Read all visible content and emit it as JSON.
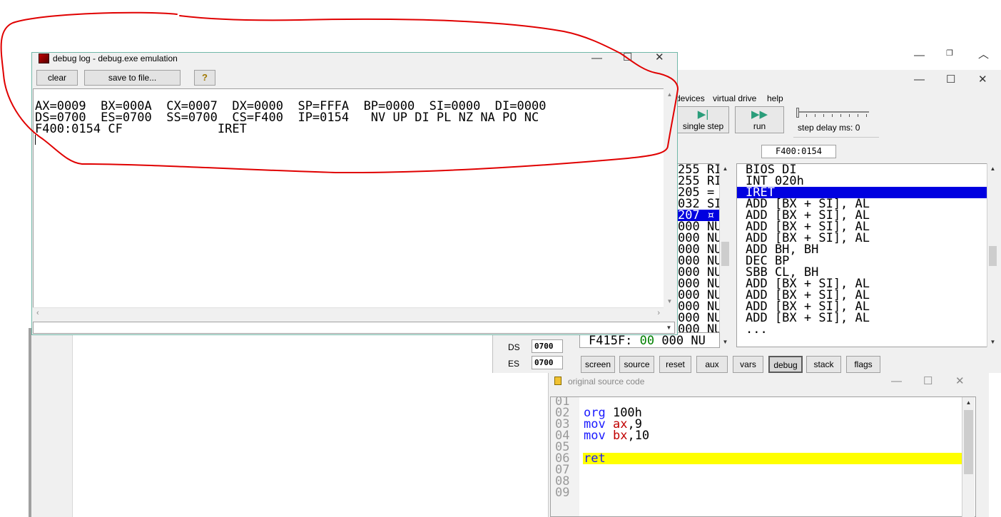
{
  "debug_log_window": {
    "title": "debug log - debug.exe emulation",
    "clear_label": "clear",
    "save_label": "save to file...",
    "help_glyph": "?",
    "lines": [
      "AX=0009  BX=000A  CX=0007  DX=0000  SP=FFFA  BP=0000  SI=0000  DI=0000",
      "DS=0700  ES=0700  SS=0700  CS=F400  IP=0154   NV UP DI PL NZ NA PO NC",
      "F400:0154 CF             IRET"
    ]
  },
  "emulator": {
    "menu": [
      "devices",
      "virtual drive",
      "help"
    ],
    "single_step_label": "single step",
    "run_label": "run",
    "step_delay_label": "step delay ms: 0",
    "address": "F400:0154",
    "memory_rows": [
      "255 RI",
      "255 RI",
      "205 =",
      "032 SI",
      "207 ¤",
      "000 NU",
      "000 NU",
      "000 NU",
      "000 NU",
      "000 NU",
      "000 NU",
      "000 NU",
      "000 NU",
      "000 NU",
      "000 NU"
    ],
    "memory_selected_index": 4,
    "memory_bottom": {
      "addr": "F415F:",
      "value": "00",
      "rest": " 000 NU"
    },
    "disassembly": [
      "BIOS DI",
      "INT 020h",
      "IRET",
      "ADD [BX + SI], AL",
      "ADD [BX + SI], AL",
      "ADD [BX + SI], AL",
      "ADD [BX + SI], AL",
      "ADD BH, BH",
      "DEC BP",
      "SBB CL, BH",
      "ADD [BX + SI], AL",
      "ADD [BX + SI], AL",
      "ADD [BX + SI], AL",
      "ADD [BX + SI], AL",
      "..."
    ],
    "disassembly_selected_index": 2,
    "registers": [
      {
        "name": "DS",
        "value": "0700"
      },
      {
        "name": "ES",
        "value": "0700"
      }
    ],
    "bottom_buttons": [
      "screen",
      "source",
      "reset",
      "aux",
      "vars",
      "debug",
      "stack",
      "flags"
    ],
    "active_bottom_button": "debug"
  },
  "source_window": {
    "title": "original source code",
    "lines": [
      {
        "num": "01",
        "tokens": []
      },
      {
        "num": "02",
        "tokens": [
          {
            "t": "org",
            "c": "kw"
          },
          {
            "t": " 100h",
            "c": ""
          }
        ]
      },
      {
        "num": "03",
        "tokens": [
          {
            "t": "mov",
            "c": "kw"
          },
          {
            "t": " ",
            "c": ""
          },
          {
            "t": "ax",
            "c": "rg"
          },
          {
            "t": ",9",
            "c": ""
          }
        ]
      },
      {
        "num": "04",
        "tokens": [
          {
            "t": "mov",
            "c": "kw"
          },
          {
            "t": " ",
            "c": ""
          },
          {
            "t": "bx",
            "c": "rg"
          },
          {
            "t": ",10",
            "c": ""
          }
        ]
      },
      {
        "num": "05",
        "tokens": []
      },
      {
        "num": "06",
        "tokens": [
          {
            "t": "ret",
            "c": "kw"
          }
        ]
      },
      {
        "num": "07",
        "tokens": []
      },
      {
        "num": "08",
        "tokens": []
      },
      {
        "num": "09",
        "tokens": []
      }
    ],
    "highlight_line": "06",
    "highlight_color": "#ffff00"
  },
  "colors": {
    "selection": "#0000e0",
    "annotation": "#e00000",
    "keyword": "#1a1aff",
    "register": "#c00000"
  }
}
